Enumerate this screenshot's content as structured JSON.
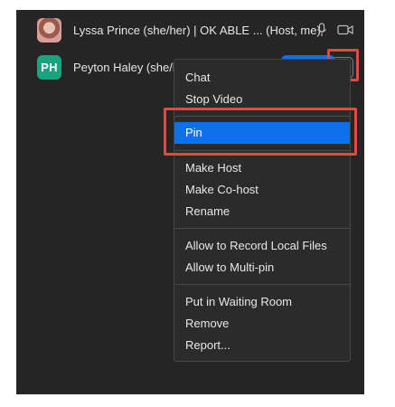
{
  "participants": [
    {
      "name": "Lyssa Prince (she/her) | OK ABLE ... (Host, me)",
      "avatar_type": "photo",
      "icons": [
        "microphone-icon",
        "video-camera-icon"
      ]
    },
    {
      "name": "Peyton Haley (she/her)",
      "avatar_type": "initials",
      "initials": "PH",
      "avatar_color": "#19a47f"
    }
  ],
  "context_menu": {
    "groups": [
      [
        "Chat",
        "Stop Video"
      ],
      [
        "Pin"
      ],
      [
        "Make Host",
        "Make Co-host",
        "Rename"
      ],
      [
        "Allow to Record Local Files",
        "Allow to Multi-pin"
      ],
      [
        "Put in Waiting Room",
        "Remove",
        "Report..."
      ]
    ],
    "highlighted_item": "Pin"
  },
  "colors": {
    "panel_bg": "#252525",
    "menu_bg": "#2b2b2b",
    "accent": "#0e71eb",
    "annotation": "#e04a3f"
  }
}
